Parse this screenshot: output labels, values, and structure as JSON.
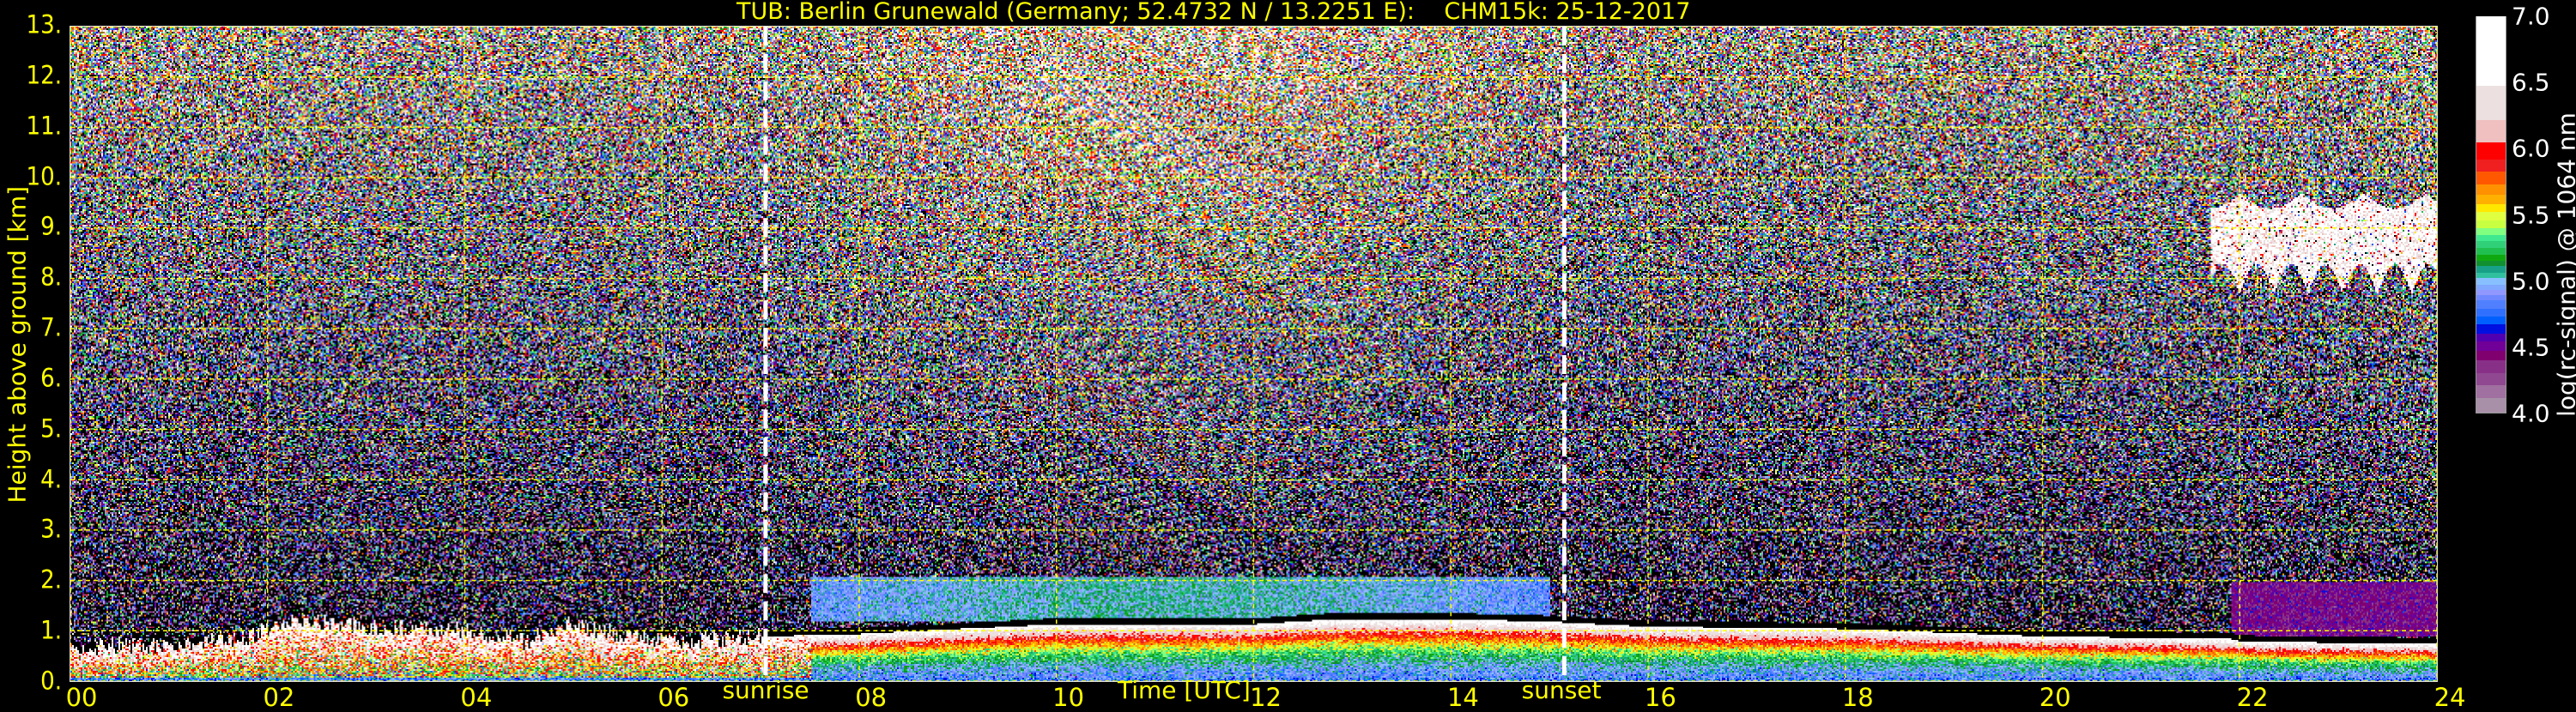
{
  "chart_data": {
    "type": "heatmap",
    "title": "TUB: Berlin Grunewald (Germany; 52.4732 N / 13.2251 E):    CHM15k: 25-12-2017",
    "xlabel": "Time [UTC]",
    "ylabel": "Height above ground [km]",
    "xlim": [
      0,
      24
    ],
    "ylim": [
      0,
      13
    ],
    "xticks": [
      {
        "v": 0,
        "label": "00"
      },
      {
        "v": 2,
        "label": "02"
      },
      {
        "v": 4,
        "label": "04"
      },
      {
        "v": 6,
        "label": "06"
      },
      {
        "v": 8,
        "label": "08"
      },
      {
        "v": 10,
        "label": "10"
      },
      {
        "v": 12,
        "label": "12"
      },
      {
        "v": 14,
        "label": "14"
      },
      {
        "v": 16,
        "label": "16"
      },
      {
        "v": 18,
        "label": "18"
      },
      {
        "v": 20,
        "label": "20"
      },
      {
        "v": 22,
        "label": "22"
      },
      {
        "v": 24,
        "label": "24"
      }
    ],
    "yticks": [
      {
        "v": 0,
        "label": "0."
      },
      {
        "v": 1,
        "label": "1."
      },
      {
        "v": 2,
        "label": "2."
      },
      {
        "v": 3,
        "label": "3."
      },
      {
        "v": 4,
        "label": "4."
      },
      {
        "v": 5,
        "label": "5."
      },
      {
        "v": 6,
        "label": "6."
      },
      {
        "v": 7,
        "label": "7."
      },
      {
        "v": 8,
        "label": "8."
      },
      {
        "v": 9,
        "label": "9."
      },
      {
        "v": 10,
        "label": "10."
      },
      {
        "v": 11,
        "label": "11."
      },
      {
        "v": 12,
        "label": "12."
      },
      {
        "v": 13,
        "label": "13."
      }
    ],
    "grid": true,
    "grid_color": "#ffff00",
    "annotations": [
      {
        "label": "sunrise",
        "time": 7.05
      },
      {
        "label": "sunset",
        "time": 15.15
      }
    ],
    "colorbar": {
      "label": "log(rc-signal) @ 1064 nm",
      "range": [
        4.0,
        7.0
      ],
      "ticks": [
        {
          "v": 4.0,
          "label": "4.0"
        },
        {
          "v": 4.5,
          "label": "4.5"
        },
        {
          "v": 5.0,
          "label": "5.0"
        },
        {
          "v": 5.5,
          "label": "5.5"
        },
        {
          "v": 6.0,
          "label": "6.0"
        },
        {
          "v": 6.5,
          "label": "6.5"
        },
        {
          "v": 7.0,
          "label": "7.0"
        }
      ],
      "levels": [
        [
          4.0,
          "#a890a8"
        ],
        [
          4.11,
          "#a070a0"
        ],
        [
          4.21,
          "#904890"
        ],
        [
          4.3,
          "#883088"
        ],
        [
          4.4,
          "#800070"
        ],
        [
          4.47,
          "#700098"
        ],
        [
          4.54,
          "#5000b0"
        ],
        [
          4.6,
          "#0010e0"
        ],
        [
          4.67,
          "#0060ff"
        ],
        [
          4.73,
          "#3070ff"
        ],
        [
          4.79,
          "#5080ff"
        ],
        [
          4.85,
          "#7088ff"
        ],
        [
          4.89,
          "#9098ff"
        ],
        [
          4.93,
          "#80a8ff"
        ],
        [
          4.97,
          "#88c0ff"
        ],
        [
          5.02,
          "#30c0a0"
        ],
        [
          5.06,
          "#18a088"
        ],
        [
          5.11,
          "#109030"
        ],
        [
          5.15,
          "#10a810"
        ],
        [
          5.2,
          "#20c050"
        ],
        [
          5.25,
          "#30d078"
        ],
        [
          5.3,
          "#40e890"
        ],
        [
          5.35,
          "#80ff80"
        ],
        [
          5.4,
          "#c8ff40"
        ],
        [
          5.46,
          "#e0ff40"
        ],
        [
          5.52,
          "#ffe800"
        ],
        [
          5.58,
          "#ffb000"
        ],
        [
          5.65,
          "#ff9000"
        ],
        [
          5.73,
          "#ff5800"
        ],
        [
          5.83,
          "#f02020"
        ],
        [
          5.92,
          "#ff0000"
        ],
        [
          6.05,
          "#f0c0c0"
        ],
        [
          6.22,
          "#ece0e0"
        ],
        [
          6.48,
          "#ffffff"
        ]
      ]
    },
    "boundary_layer_top_km": {
      "time": [
        0,
        1,
        1.8,
        2.2,
        3,
        4,
        4.6,
        5,
        6,
        7,
        8,
        10,
        12,
        12.8,
        14,
        15,
        16,
        18,
        20,
        21.9,
        22,
        24
      ],
      "height": [
        0.7,
        0.75,
        0.9,
        1.25,
        1.1,
        1.05,
        0.8,
        1.15,
        0.8,
        0.9,
        0.95,
        1.15,
        1.15,
        1.25,
        1.25,
        1.2,
        1.1,
        1.05,
        0.9,
        0.85,
        0.8,
        0.75
      ]
    },
    "cloud_layer": {
      "time_start": 21.7,
      "time_end": 24,
      "base_km": 7.7,
      "top_km": 9.7
    },
    "residual_layer": {
      "time_start": 7.5,
      "time_end": 15,
      "base_km": 1.2,
      "top_km": 2.1,
      "value": 4.85
    },
    "night_layer": {
      "time_start": 21.9,
      "time_end": 24,
      "base_km": 0.9,
      "top_km": 2.0,
      "value": 4.45
    }
  }
}
